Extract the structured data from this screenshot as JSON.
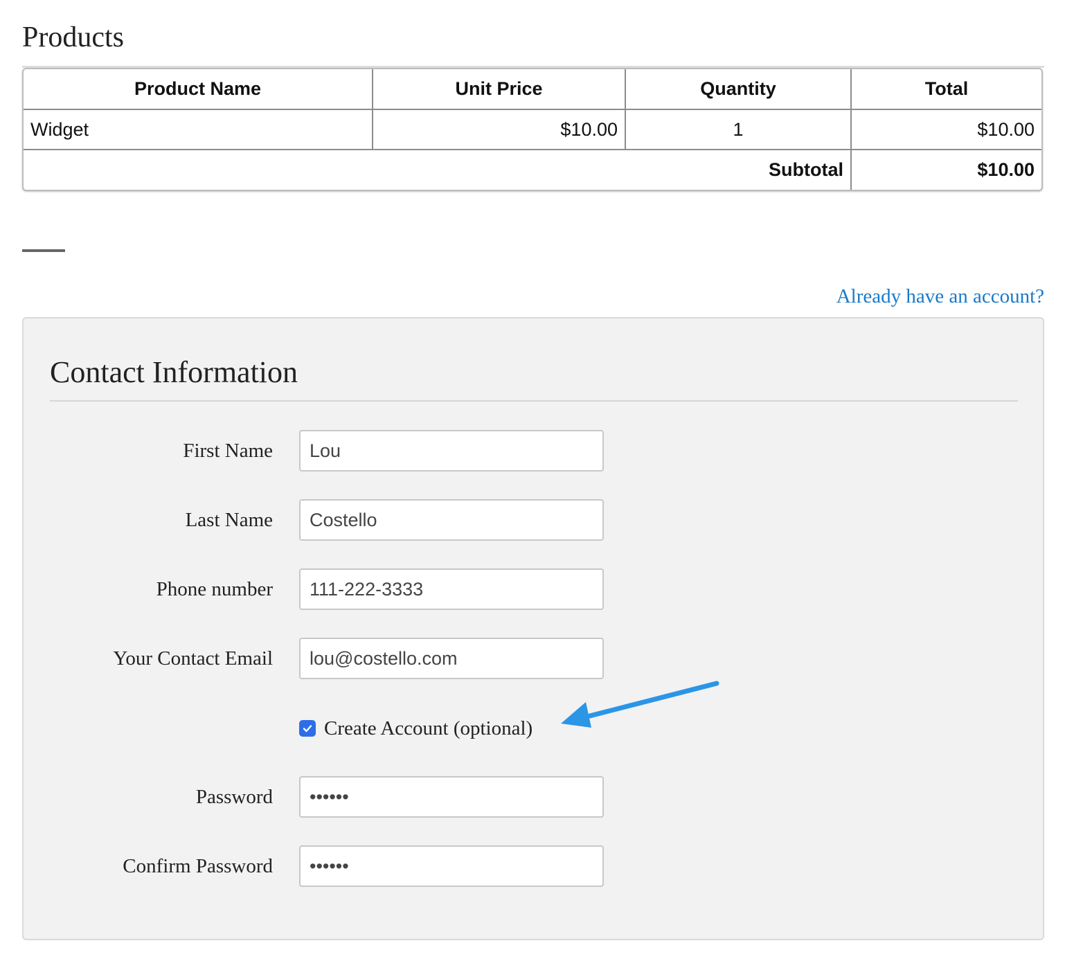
{
  "products_section": {
    "title": "Products",
    "table": {
      "headers": [
        "Product Name",
        "Unit Price",
        "Quantity",
        "Total"
      ],
      "rows": [
        {
          "product_name": "Widget",
          "unit_price": "$10.00",
          "quantity": "1",
          "total": "$10.00"
        }
      ],
      "subtotal_label": "Subtotal",
      "subtotal_value": "$10.00"
    }
  },
  "account_link": "Already have an account?",
  "contact": {
    "title": "Contact Information",
    "fields": {
      "first_name": {
        "label": "First Name",
        "value": "Lou"
      },
      "last_name": {
        "label": "Last Name",
        "value": "Costello"
      },
      "phone": {
        "label": "Phone number",
        "value": "111-222-3333"
      },
      "email": {
        "label": "Your Contact Email",
        "value": "lou@costello.com"
      },
      "password": {
        "label": "Password",
        "value": "••••••"
      },
      "confirm_password": {
        "label": "Confirm Password",
        "value": "••••••"
      }
    },
    "create_account": {
      "label": "Create Account (optional)",
      "checked": true
    }
  },
  "colors": {
    "link": "#1a7ac8",
    "checkbox": "#2e6de8",
    "annotation_arrow": "#2b95e6",
    "panel_background": "#f2f2f2"
  },
  "icons": {
    "checkbox_check": "check-icon",
    "annotation": "arrow-icon"
  }
}
